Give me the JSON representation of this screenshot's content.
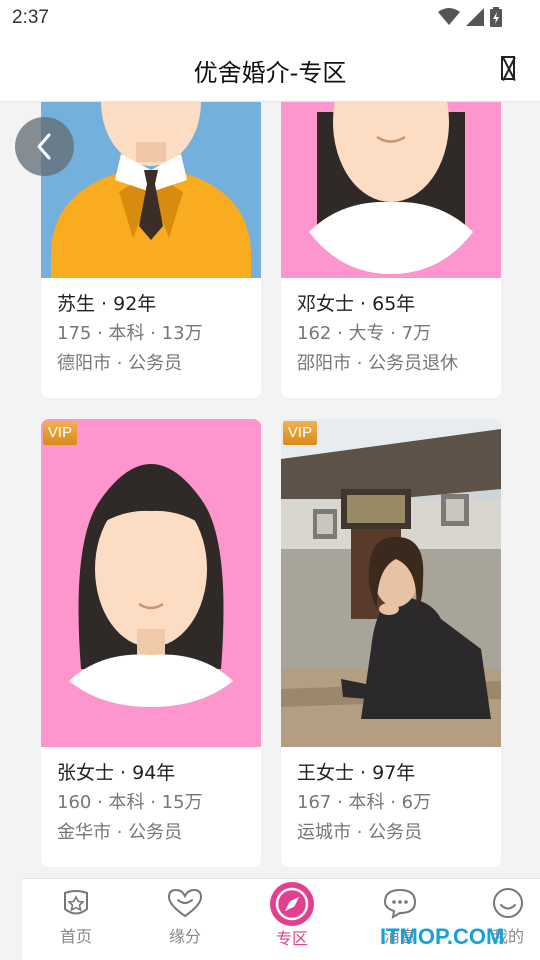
{
  "status": {
    "time": "2:37"
  },
  "header": {
    "title": "优舍婚介-专区"
  },
  "profiles": [
    {
      "name": "苏生 · 92年",
      "details": "175 · 本科 · 13万",
      "location": "德阳市 · 公务员",
      "vip": "",
      "photo": "male-avatar"
    },
    {
      "name": "邓女士 · 65年",
      "details": "162 · 大专 · 7万",
      "location": "邵阳市 · 公务员退休",
      "vip": "",
      "photo": "female-avatar"
    },
    {
      "name": "张女士 · 94年",
      "details": "160 · 本科 · 15万",
      "location": "金华市 · 公务员",
      "vip": "VIP",
      "photo": "female-avatar"
    },
    {
      "name": "王女士 · 97年",
      "details": "167 · 本科 · 6万",
      "location": "运城市 · 公务员",
      "vip": "VIP",
      "photo": "user-photo"
    }
  ],
  "tabs": [
    {
      "label": "首页",
      "icon": "home-star-icon"
    },
    {
      "label": "缘分",
      "icon": "heart-icon"
    },
    {
      "label": "专区",
      "icon": "compass-icon",
      "active": true
    },
    {
      "label": "消息",
      "icon": "chat-icon"
    },
    {
      "label": "我的",
      "icon": "smiley-icon"
    }
  ],
  "watermark": "ITMOP.COM",
  "colors": {
    "accent": "#e23f8f",
    "male_bg": "#74b0dc",
    "female_bg": "#fd96cd",
    "vip": "#e49a2c"
  }
}
